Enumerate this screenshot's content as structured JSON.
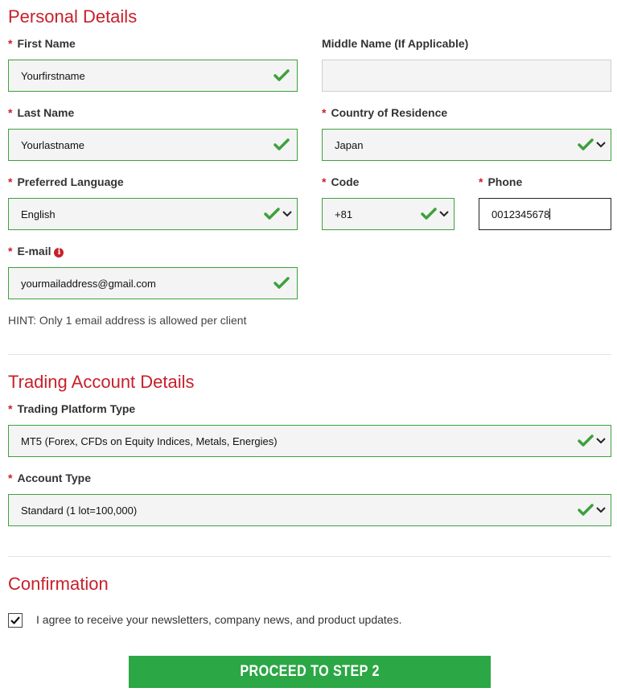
{
  "sections": {
    "personal": "Personal Details",
    "trading": "Trading Account Details",
    "confirmation": "Confirmation"
  },
  "fields": {
    "first_name": {
      "label": "First Name",
      "value": "Yourfirstname",
      "required": true
    },
    "middle_name": {
      "label": "Middle Name (If Applicable)",
      "value": ""
    },
    "last_name": {
      "label": "Last Name",
      "value": "Yourlastname",
      "required": true
    },
    "country": {
      "label": "Country of Residence",
      "value": "Japan",
      "required": true
    },
    "language": {
      "label": "Preferred Language",
      "value": "English",
      "required": true
    },
    "code": {
      "label": "Code",
      "value": "+81",
      "required": true
    },
    "phone": {
      "label": "Phone",
      "value": "0012345678",
      "required": true
    },
    "email": {
      "label": "E-mail",
      "value": "yourmailaddress@gmail.com",
      "required": true
    },
    "platform": {
      "label": "Trading Platform Type",
      "value": "MT5 (Forex, CFDs on Equity Indices, Metals, Energies)",
      "required": true
    },
    "account_type": {
      "label": "Account Type",
      "value": "Standard (1 lot=100,000)",
      "required": true
    }
  },
  "required_marker": "*",
  "email_hint": "HINT: Only 1 email address is allowed per client",
  "newsletter": {
    "label": "I agree to receive your newsletters, company news, and product updates.",
    "checked": true
  },
  "proceed_label": "PROCEED TO STEP 2",
  "colors": {
    "accent_red": "#c8202b",
    "valid_green": "#3da13d",
    "button_green": "#2ba745"
  },
  "icons": {
    "valid": "checkmark-icon",
    "dropdown": "chevron-down-icon",
    "info": "info-icon"
  }
}
